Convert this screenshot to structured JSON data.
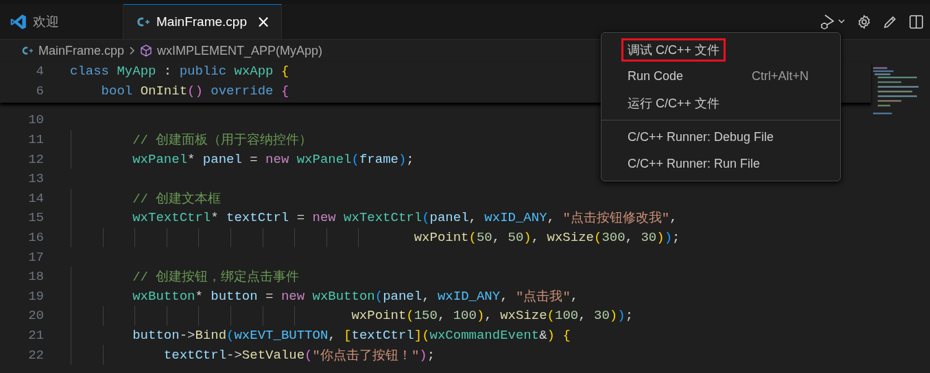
{
  "tabs": [
    {
      "label": "欢迎",
      "selected": false
    },
    {
      "label": "MainFrame.cpp",
      "selected": true,
      "close": "×"
    }
  ],
  "breadcrumbs": [
    {
      "label": "MainFrame.cpp"
    },
    {
      "label": "wxIMPLEMENT_APP(MyApp)"
    }
  ],
  "sticky_lines": [
    {
      "number": "4",
      "tokens": [
        {
          "kind": "kw",
          "text": "class "
        },
        {
          "kind": "type",
          "text": "MyApp"
        },
        {
          "kind": "p",
          "text": " : "
        },
        {
          "kind": "kw",
          "text": "public "
        },
        {
          "kind": "type",
          "text": "wxApp "
        },
        {
          "kind": "b1",
          "text": "{"
        }
      ]
    },
    {
      "number": "6",
      "tokens": [
        {
          "kind": "kw",
          "text": "    bool "
        },
        {
          "kind": "fn",
          "text": "OnInit"
        },
        {
          "kind": "b2",
          "text": "() "
        },
        {
          "kind": "kw",
          "text": "override "
        },
        {
          "kind": "b2",
          "text": "{"
        }
      ]
    }
  ],
  "code_lines": [
    {
      "number": "10"
    },
    {
      "number": "11",
      "tokens": [
        {
          "kind": "cm",
          "text": "        // 创建面板（用于容纳控件）"
        }
      ]
    },
    {
      "number": "12",
      "tokens": [
        {
          "kind": "type",
          "text": "        wxPanel"
        },
        {
          "kind": "p",
          "text": "* "
        },
        {
          "kind": "var",
          "text": "panel"
        },
        {
          "kind": "p",
          "text": " = "
        },
        {
          "kind": "ctl",
          "text": "new "
        },
        {
          "kind": "type",
          "text": "wxPanel"
        },
        {
          "kind": "b3",
          "text": "("
        },
        {
          "kind": "var",
          "text": "frame"
        },
        {
          "kind": "b3",
          "text": ")"
        },
        {
          "kind": "p",
          "text": ";"
        }
      ]
    },
    {
      "number": "13"
    },
    {
      "number": "14",
      "tokens": [
        {
          "kind": "cm",
          "text": "        // 创建文本框"
        }
      ]
    },
    {
      "number": "15",
      "tokens": [
        {
          "kind": "type",
          "text": "        wxTextCtrl"
        },
        {
          "kind": "p",
          "text": "* "
        },
        {
          "kind": "var",
          "text": "textCtrl"
        },
        {
          "kind": "p",
          "text": " = "
        },
        {
          "kind": "ctl",
          "text": "new "
        },
        {
          "kind": "type",
          "text": "wxTextCtrl"
        },
        {
          "kind": "b3",
          "text": "("
        },
        {
          "kind": "var",
          "text": "panel"
        },
        {
          "kind": "p",
          "text": ", "
        },
        {
          "kind": "mac",
          "text": "wxID_ANY"
        },
        {
          "kind": "p",
          "text": ", "
        },
        {
          "kind": "str",
          "text": "\"点击按钮修改我\""
        },
        {
          "kind": "p",
          "text": ","
        }
      ]
    },
    {
      "number": "16",
      "tokens": [
        {
          "kind": "fn",
          "text": "                                            wxPoint"
        },
        {
          "kind": "b1",
          "text": "("
        },
        {
          "kind": "num",
          "text": "50"
        },
        {
          "kind": "p",
          "text": ", "
        },
        {
          "kind": "num",
          "text": "50"
        },
        {
          "kind": "b1",
          "text": ")"
        },
        {
          "kind": "p",
          "text": ", "
        },
        {
          "kind": "fn",
          "text": "wxSize"
        },
        {
          "kind": "b1",
          "text": "("
        },
        {
          "kind": "num",
          "text": "300"
        },
        {
          "kind": "p",
          "text": ", "
        },
        {
          "kind": "num",
          "text": "30"
        },
        {
          "kind": "b1",
          "text": ")"
        },
        {
          "kind": "b3",
          "text": ")"
        },
        {
          "kind": "p",
          "text": ";"
        }
      ]
    },
    {
      "number": "17"
    },
    {
      "number": "18",
      "tokens": [
        {
          "kind": "cm",
          "text": "        // 创建按钮，绑定点击事件"
        }
      ]
    },
    {
      "number": "19",
      "tokens": [
        {
          "kind": "type",
          "text": "        wxButton"
        },
        {
          "kind": "p",
          "text": "* "
        },
        {
          "kind": "var",
          "text": "button"
        },
        {
          "kind": "p",
          "text": " = "
        },
        {
          "kind": "ctl",
          "text": "new "
        },
        {
          "kind": "type",
          "text": "wxButton"
        },
        {
          "kind": "b3",
          "text": "("
        },
        {
          "kind": "var",
          "text": "panel"
        },
        {
          "kind": "p",
          "text": ", "
        },
        {
          "kind": "mac",
          "text": "wxID_ANY"
        },
        {
          "kind": "p",
          "text": ", "
        },
        {
          "kind": "str",
          "text": "\"点击我\""
        },
        {
          "kind": "p",
          "text": ","
        }
      ]
    },
    {
      "number": "20",
      "tokens": [
        {
          "kind": "fn",
          "text": "                                    wxPoint"
        },
        {
          "kind": "b1",
          "text": "("
        },
        {
          "kind": "num",
          "text": "150"
        },
        {
          "kind": "p",
          "text": ", "
        },
        {
          "kind": "num",
          "text": "100"
        },
        {
          "kind": "b1",
          "text": ")"
        },
        {
          "kind": "p",
          "text": ", "
        },
        {
          "kind": "fn",
          "text": "wxSize"
        },
        {
          "kind": "b1",
          "text": "("
        },
        {
          "kind": "num",
          "text": "100"
        },
        {
          "kind": "p",
          "text": ", "
        },
        {
          "kind": "num",
          "text": "30"
        },
        {
          "kind": "b1",
          "text": ")"
        },
        {
          "kind": "b3",
          "text": ")"
        },
        {
          "kind": "p",
          "text": ";"
        }
      ]
    },
    {
      "number": "21",
      "tokens": [
        {
          "kind": "var",
          "text": "        button"
        },
        {
          "kind": "p",
          "text": "->"
        },
        {
          "kind": "fn",
          "text": "Bind"
        },
        {
          "kind": "b3",
          "text": "("
        },
        {
          "kind": "mac",
          "text": "wxEVT_BUTTON"
        },
        {
          "kind": "p",
          "text": ", "
        },
        {
          "kind": "b1",
          "text": "["
        },
        {
          "kind": "var",
          "text": "textCtrl"
        },
        {
          "kind": "b1",
          "text": "]("
        },
        {
          "kind": "type",
          "text": "wxCommandEvent"
        },
        {
          "kind": "p",
          "text": "&"
        },
        {
          "kind": "b1",
          "text": ") {"
        }
      ]
    },
    {
      "number": "22",
      "tokens": [
        {
          "kind": "var",
          "text": "            textCtrl"
        },
        {
          "kind": "p",
          "text": "->"
        },
        {
          "kind": "fn",
          "text": "SetValue"
        },
        {
          "kind": "b2",
          "text": "("
        },
        {
          "kind": "str",
          "text": "\"你点击了按钮！\""
        },
        {
          "kind": "b2",
          "text": ")"
        },
        {
          "kind": "p",
          "text": ";"
        }
      ]
    }
  ],
  "menu": {
    "groups": [
      [
        {
          "label": "调试 C/C++ 文件",
          "highlighted": true
        },
        {
          "label": "Run Code",
          "shortcut": "Ctrl+Alt+N",
          "highlighted": false
        },
        {
          "label": "运行 C/C++ 文件",
          "highlighted": false
        }
      ],
      [
        {
          "label": "C/C++ Runner: Debug File",
          "highlighted": false
        },
        {
          "label": "C/C++ Runner: Run File",
          "highlighted": false
        }
      ]
    ]
  }
}
